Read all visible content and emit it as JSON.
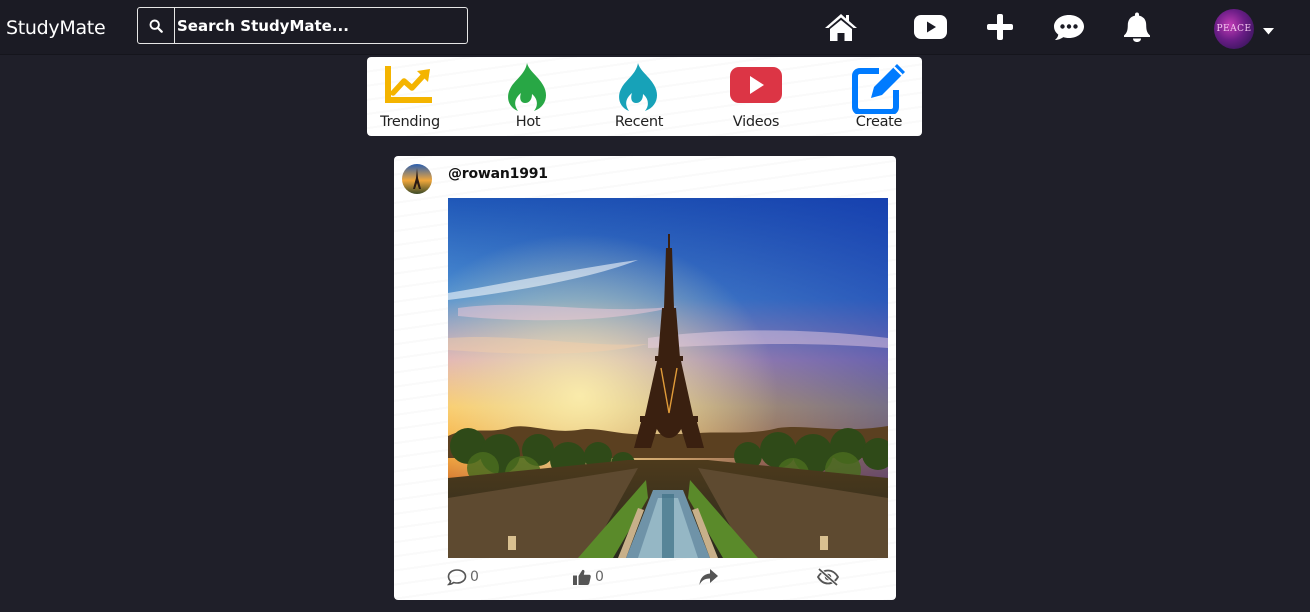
{
  "app": {
    "brand": "StudyMate"
  },
  "search": {
    "placeholder": "Search StudyMate..."
  },
  "nav": {
    "icons": [
      "home-icon",
      "youtube-icon",
      "plus-icon",
      "chat-icon",
      "bell-icon"
    ],
    "profile_avatar_text": "PEACE"
  },
  "categories": [
    {
      "label": "Trending",
      "icon": "trending-icon",
      "color": "#f4b400"
    },
    {
      "label": "Hot",
      "icon": "fire-icon",
      "color": "#28a745"
    },
    {
      "label": "Recent",
      "icon": "fire-icon",
      "color": "#17a2b8"
    },
    {
      "label": "Videos",
      "icon": "youtube-icon",
      "color": "#dc3545"
    },
    {
      "label": "Create",
      "icon": "edit-icon",
      "color": "#007bff"
    }
  ],
  "post": {
    "username": "@rowan1991",
    "comments": "0",
    "likes": "0"
  },
  "colors": {
    "background": "#1f1f29",
    "nav_background": "#1b1b24"
  }
}
